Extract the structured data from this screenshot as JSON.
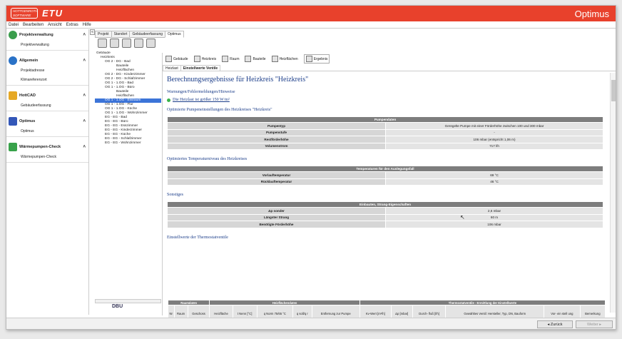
{
  "app": {
    "logo_line1": "HOTTGENROTH",
    "logo_line2": "SOFTWARE",
    "brand": "ETU",
    "title": "Optimus"
  },
  "menu": [
    "Datei",
    "Bearbeiten",
    "Ansicht",
    "Extras",
    "Hilfe"
  ],
  "sidebar": [
    {
      "title": "Projektverwaltung",
      "item": "Projektverwaltung",
      "color": "#3a9d4c"
    },
    {
      "title": "Allgemein",
      "item": "Projektadresse",
      "item2": "Klimareferenzort",
      "color": "#2a72c7"
    },
    {
      "title": "HottCAD",
      "item": "Gebäudeerfassung",
      "color": "#e6a824"
    },
    {
      "title": "Optimus",
      "item": "Optimus",
      "color": "#3357b8"
    },
    {
      "title": "Wärmepumpen-Check",
      "item": "Wärmepumpen-Check",
      "color": "#38a24a"
    }
  ],
  "tabs": [
    "Projekt",
    "Standort",
    "Gebäudeerfassung",
    "Optimus"
  ],
  "tree": [
    "Gebäude",
    "Heizkreis",
    "OG 2 - DG - Bad",
    "Bauteile",
    "Heizflächen",
    "OG 2 - DG - Kinderzimmer",
    "OG 2 - DG - Schlafzimmer",
    "OG 1 - 1.OG - Bad",
    "OG 1 - 1.OG - Büro",
    "Bauteile",
    "Heizflächen",
    "OG 1 - 1.OG - Essraum",
    "OG 1 - 1.OG - Flur",
    "OG 1 - 1.OG - Küche",
    "OG 1 - 1.OG - Wohnzimmer",
    "EG - EG - Bad",
    "EG - EG - Büro",
    "EG - EG - Esszimmer",
    "EG - EG - Kinderzimmer",
    "EG - EG - Küche",
    "EG - EG - Schlafzimmer",
    "EG - EG - Wohnzimmer"
  ],
  "resultbar": [
    "Gebäude",
    "Heizkreis",
    "Raum",
    "Bauteile",
    "Heizflächen",
    "Ergebnis"
  ],
  "subtabs": [
    "Heizlast",
    "Einstellwerte Ventile"
  ],
  "content": {
    "title": "Berechnungsergebnisse für Heizkreis \"Heizkreis\"",
    "warnings_heading": "Warnungen/Fehlermeldungen/Hinweise",
    "warning": "Die Heizlast ist größer 150 W/m²",
    "pump_heading": "Optimierte Pumpeneinstellungen des Heizkreises \"Heizkreis\"",
    "pump_table_title": "Pumpendaten",
    "pump_rows": [
      [
        "Pumpentyp",
        "Geregelte Pumpe mit einer Förderhöhe zwischen 100 und 300 mbar"
      ],
      [
        "Pumpenstufe",
        "-"
      ],
      [
        "Restförderhöhe",
        "106 mbar (entspricht 1,06 m)"
      ],
      [
        "Volumenstrom",
        "717 l/h"
      ]
    ],
    "temp_heading": "Optimiertes Temperaturniveau des Heizkreises",
    "temp_table_title": "Temperaturen für den Auslegungsfall",
    "temp_rows": [
      [
        "Vorlauftemperatur",
        "69 °C"
      ],
      [
        "Rücklauftemperatur",
        "46 °C"
      ]
    ],
    "misc_heading": "Sonstiges",
    "misc_table_title": "Einbauten, Strang-Eigenschaften",
    "misc_rows": [
      [
        "Δp sonder",
        "2,6 mbar"
      ],
      [
        "Längster Strang",
        "60 m"
      ],
      [
        "Benötigte Förderhöhe",
        "106 mbar"
      ]
    ],
    "thermo_heading": "Einstellwerte der Thermostatventile",
    "thermo_groups": [
      "Raumdaten",
      "Heizflächendaten",
      "Thermostatventile - Ermittlung der Einstellwerte"
    ],
    "thermo_cols": [
      "Nr",
      "Raum",
      "Geschoss",
      "Heizfläche",
      "t Nenn [°C]",
      "q Norm 75/65 °C",
      "q soll/q r",
      "Entfernung zur Pumpe",
      "Kv-Wert [m³/h]",
      "Δp [mbar]",
      "Durch- fluß [l/h]",
      "Gewähltes Ventil: Hersteller, Typ, DN, Bauform",
      "Vor- ein stell ung",
      "Bemerkung"
    ]
  },
  "footer": {
    "back": "Zurück",
    "next": "Weiter"
  }
}
